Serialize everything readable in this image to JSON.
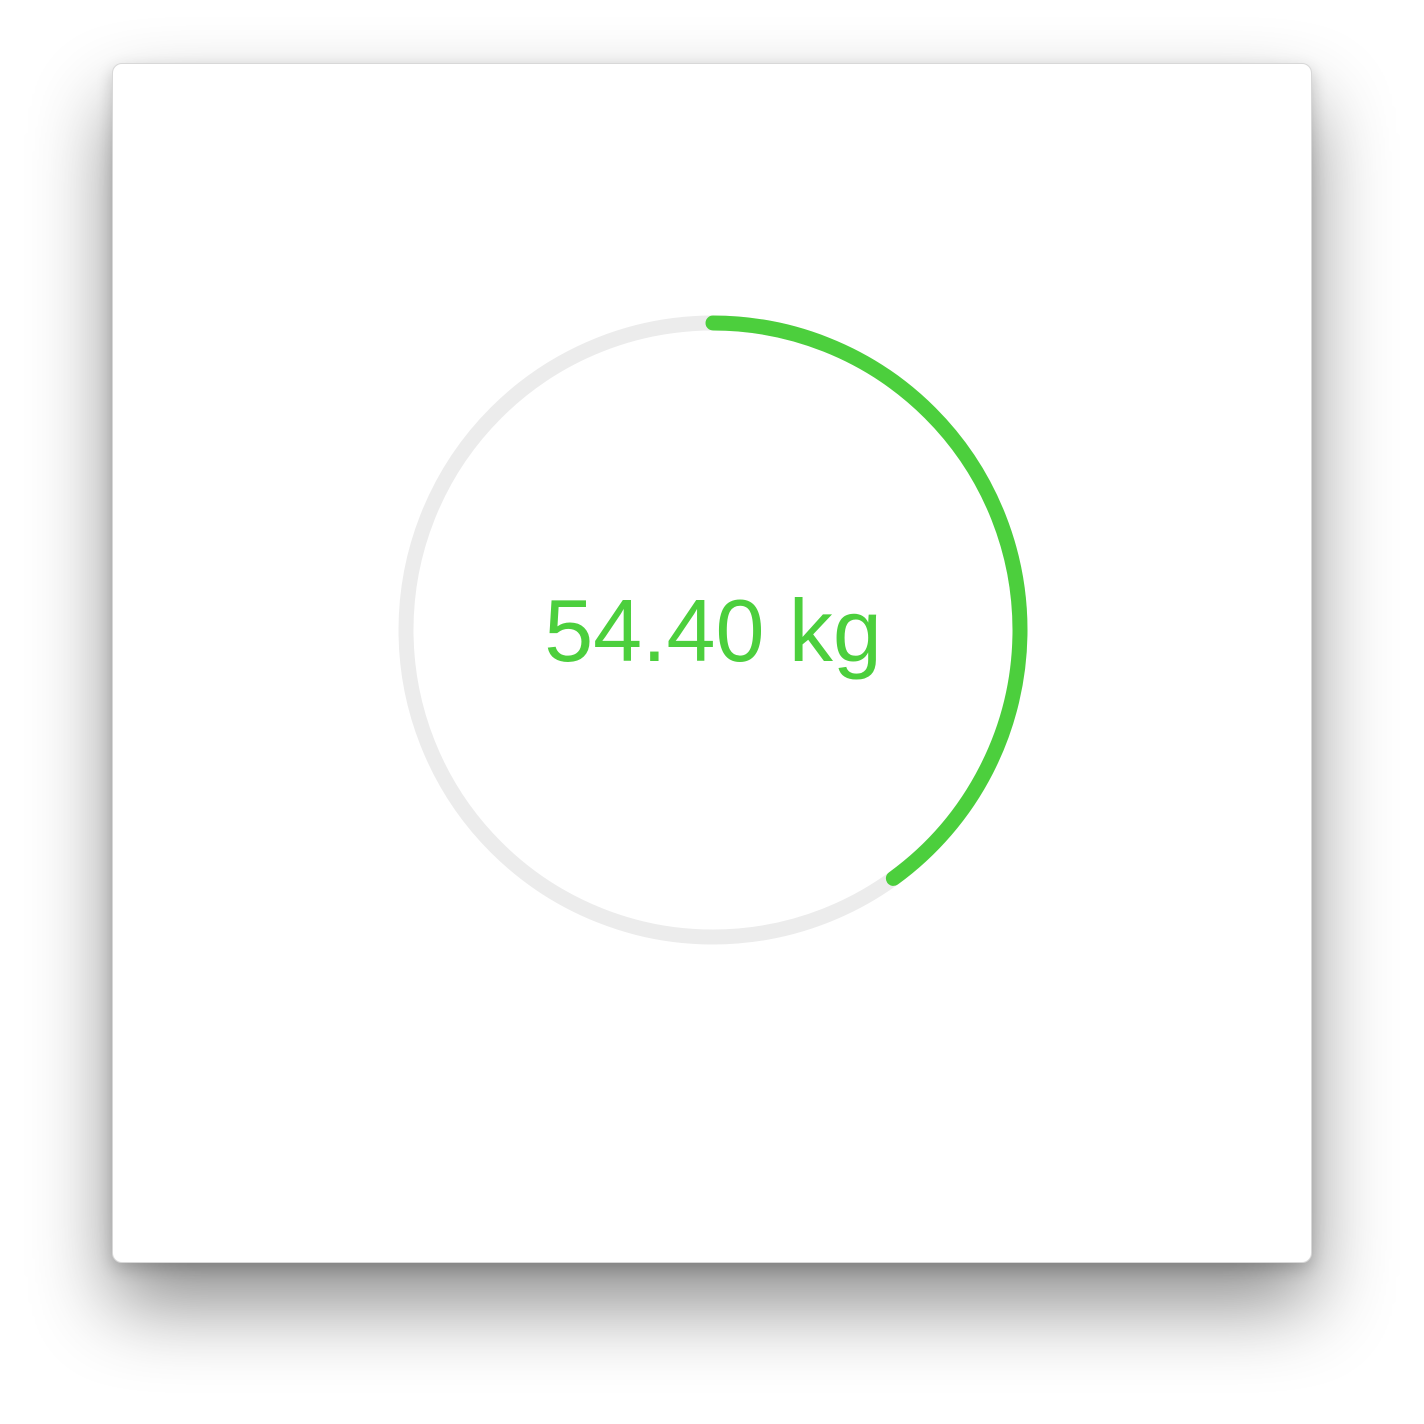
{
  "gauge": {
    "value_label": "54.40 kg",
    "progress_fraction": 0.4,
    "color_accent": "#4ccf3d",
    "color_track": "#ececec"
  }
}
